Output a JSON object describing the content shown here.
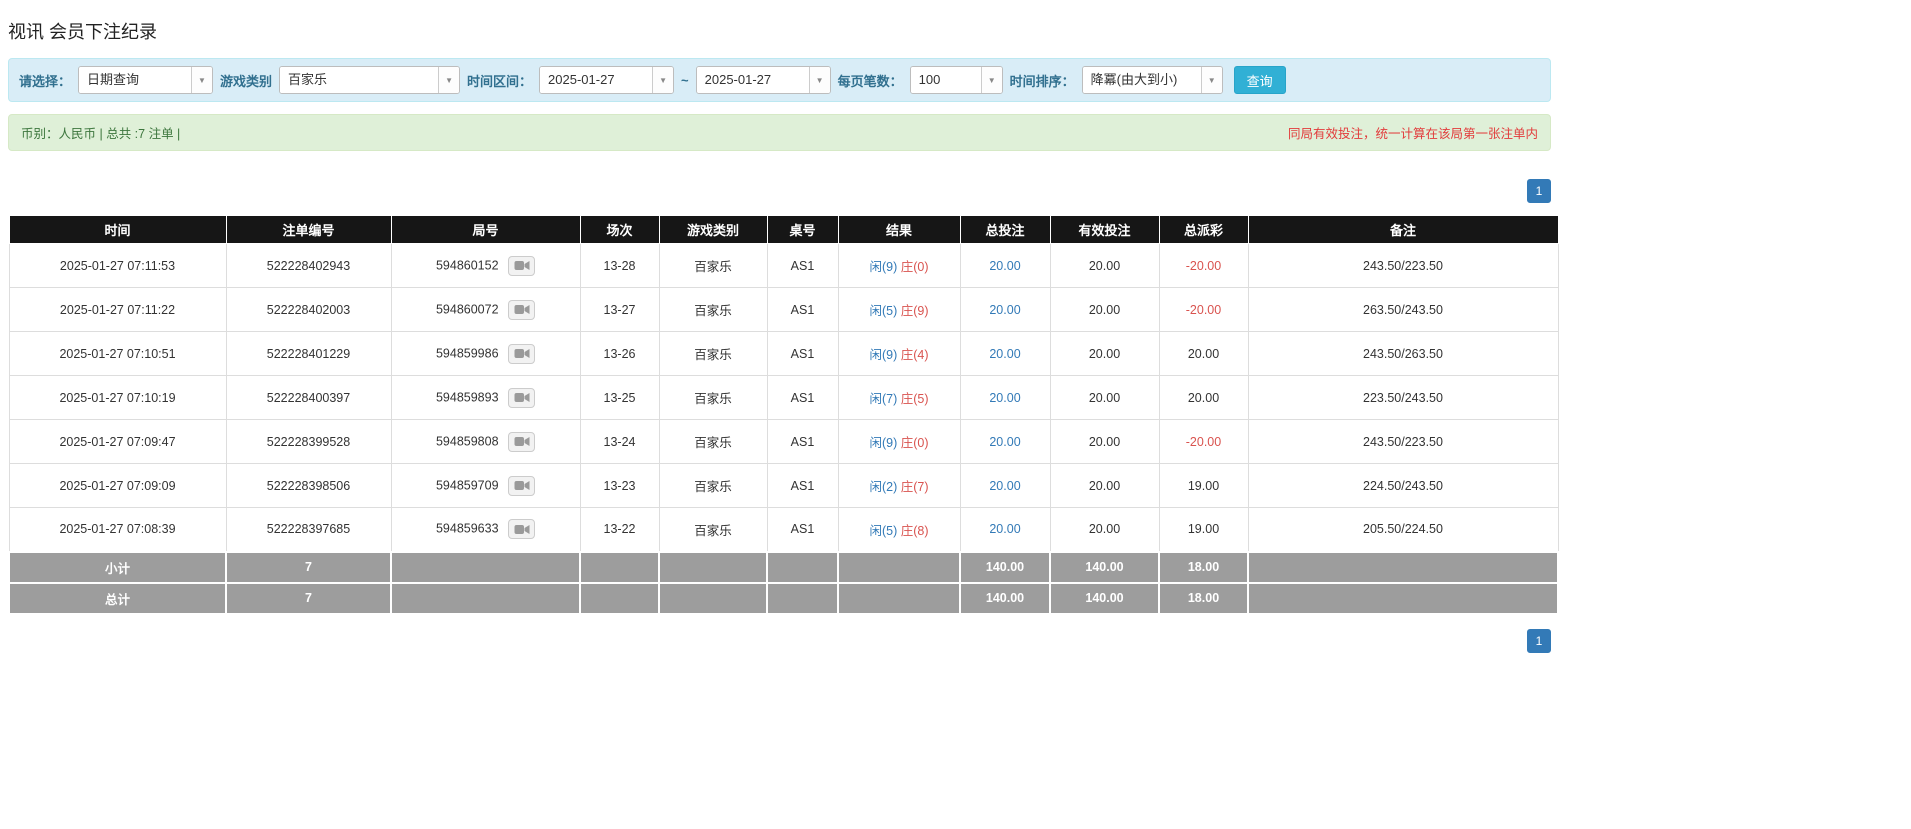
{
  "page": {
    "title": "视讯 会员下注纪录"
  },
  "filters": {
    "select_label": "请选择：",
    "select_value": "日期查询",
    "game_type_label": "游戏类别",
    "game_type_value": "百家乐",
    "date_range_label": "时间区间：",
    "date_from": "2025-01-27",
    "date_separator": "~",
    "date_to": "2025-01-27",
    "page_size_label": "每页笔数：",
    "page_size_value": "100",
    "sort_label": "时间排序：",
    "sort_value": "降冪(由大到小)",
    "search_button": "查询"
  },
  "summary": {
    "left": "币别：人民币 | 总共 :7 注单 |",
    "right": "同局有效投注，统一计算在该局第一张注单内"
  },
  "pagination": {
    "page": "1"
  },
  "table": {
    "headers": [
      "时间",
      "注单编号",
      "局号",
      "场次",
      "游戏类别",
      "桌号",
      "结果",
      "总投注",
      "有效投注",
      "总派彩",
      "备注"
    ],
    "rows": [
      {
        "time": "2025-01-27 07:11:53",
        "bet_id": "522228402943",
        "round_id": "594860152",
        "session": "13-28",
        "game": "百家乐",
        "table_no": "AS1",
        "result_player": "闲(9)",
        "result_banker": "庄(0)",
        "total_bet": "20.00",
        "valid_bet": "20.00",
        "payout": "-20.00",
        "remark": "243.50/223.50"
      },
      {
        "time": "2025-01-27 07:11:22",
        "bet_id": "522228402003",
        "round_id": "594860072",
        "session": "13-27",
        "game": "百家乐",
        "table_no": "AS1",
        "result_player": "闲(5)",
        "result_banker": "庄(9)",
        "total_bet": "20.00",
        "valid_bet": "20.00",
        "payout": "-20.00",
        "remark": "263.50/243.50"
      },
      {
        "time": "2025-01-27 07:10:51",
        "bet_id": "522228401229",
        "round_id": "594859986",
        "session": "13-26",
        "game": "百家乐",
        "table_no": "AS1",
        "result_player": "闲(9)",
        "result_banker": "庄(4)",
        "total_bet": "20.00",
        "valid_bet": "20.00",
        "payout": "20.00",
        "remark": "243.50/263.50"
      },
      {
        "time": "2025-01-27 07:10:19",
        "bet_id": "522228400397",
        "round_id": "594859893",
        "session": "13-25",
        "game": "百家乐",
        "table_no": "AS1",
        "result_player": "闲(7)",
        "result_banker": "庄(5)",
        "total_bet": "20.00",
        "valid_bet": "20.00",
        "payout": "20.00",
        "remark": "223.50/243.50"
      },
      {
        "time": "2025-01-27 07:09:47",
        "bet_id": "522228399528",
        "round_id": "594859808",
        "session": "13-24",
        "game": "百家乐",
        "table_no": "AS1",
        "result_player": "闲(9)",
        "result_banker": "庄(0)",
        "total_bet": "20.00",
        "valid_bet": "20.00",
        "payout": "-20.00",
        "remark": "243.50/223.50"
      },
      {
        "time": "2025-01-27 07:09:09",
        "bet_id": "522228398506",
        "round_id": "594859709",
        "session": "13-23",
        "game": "百家乐",
        "table_no": "AS1",
        "result_player": "闲(2)",
        "result_banker": "庄(7)",
        "total_bet": "20.00",
        "valid_bet": "20.00",
        "payout": "19.00",
        "remark": "224.50/243.50"
      },
      {
        "time": "2025-01-27 07:08:39",
        "bet_id": "522228397685",
        "round_id": "594859633",
        "session": "13-22",
        "game": "百家乐",
        "table_no": "AS1",
        "result_player": "闲(5)",
        "result_banker": "庄(8)",
        "total_bet": "20.00",
        "valid_bet": "20.00",
        "payout": "19.00",
        "remark": "205.50/224.50"
      }
    ],
    "footer": [
      {
        "name": "subtotal-row",
        "label": "小计",
        "count": "7",
        "total_bet": "140.00",
        "valid_bet": "140.00",
        "payout": "18.00"
      },
      {
        "name": "total-row",
        "label": "总计",
        "count": "7",
        "total_bet": "140.00",
        "valid_bet": "140.00",
        "payout": "18.00"
      }
    ]
  },
  "colors": {
    "accent_blue": "#337ab7",
    "player_blue": "#337ab7",
    "banker_red": "#d9534f",
    "negative_red": "#d9534f",
    "filter_bar_bg": "#d9edf7",
    "summary_bar_bg": "#dff0d8",
    "table_header_bg": "#161616",
    "table_footer_bg": "#9d9d9d",
    "search_button_bg": "#31b0d5",
    "note_red": "#e23b3b"
  }
}
